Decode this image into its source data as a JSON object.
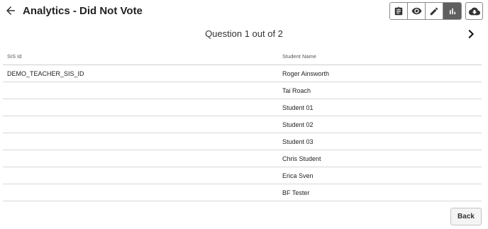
{
  "header": {
    "title": "Analytics - Did Not Vote",
    "toolbar": {
      "buttons": [
        {
          "icon": "clipboard-icon",
          "active": false
        },
        {
          "icon": "eye-icon",
          "active": false
        },
        {
          "icon": "pencil-icon",
          "active": false
        },
        {
          "icon": "bar-chart-icon",
          "active": true
        }
      ],
      "download_icon": "cloud-download-icon"
    }
  },
  "question": {
    "label": "Question 1 out of 2"
  },
  "table": {
    "columns": [
      "SIS Id",
      "Student Name"
    ],
    "rows": [
      [
        "DEMO_TEACHER_SIS_ID",
        "Roger Ainsworth"
      ],
      [
        "",
        "Tai Roach"
      ],
      [
        "",
        "Student 01"
      ],
      [
        "",
        "Student 02"
      ],
      [
        "",
        "Student 03"
      ],
      [
        "",
        "Chris Student"
      ],
      [
        "",
        "Erica Sven"
      ],
      [
        "",
        "BF Tester"
      ]
    ]
  },
  "footer": {
    "back_label": "Back"
  }
}
